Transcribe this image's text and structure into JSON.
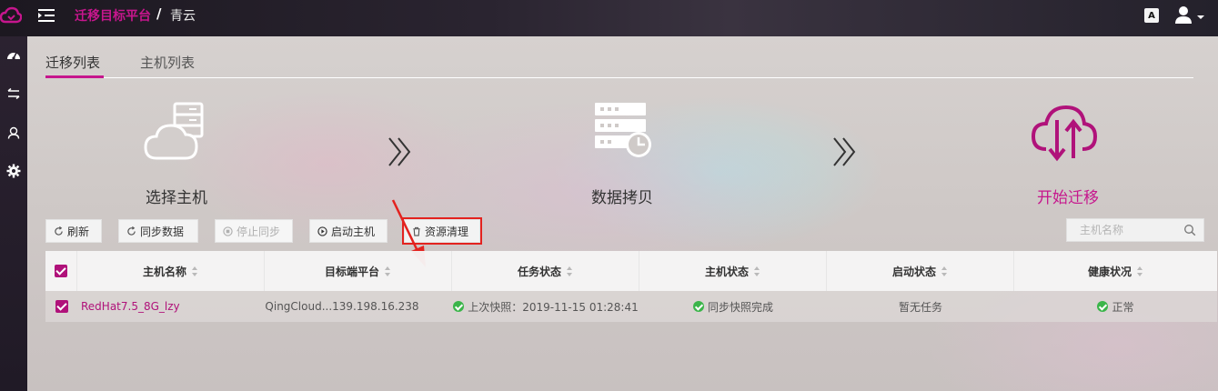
{
  "header": {
    "platform_title": "迁移目标平台",
    "separator": "/",
    "current": "青云",
    "lang_label": "A"
  },
  "sidebar": {
    "items": [
      {
        "icon": "dashboard-icon"
      },
      {
        "icon": "swap-icon"
      },
      {
        "icon": "user-icon"
      },
      {
        "icon": "gear-icon"
      }
    ]
  },
  "tabs": [
    {
      "label": "迁移列表",
      "active": true
    },
    {
      "label": "主机列表",
      "active": false
    }
  ],
  "steps": [
    {
      "label": "选择主机",
      "icon": "cloud-server-icon",
      "active": false
    },
    {
      "label": "数据拷贝",
      "icon": "server-clock-icon",
      "active": false
    },
    {
      "label": "开始迁移",
      "icon": "cloud-transfer-icon",
      "active": true
    }
  ],
  "toolbar": {
    "refresh": "刷新",
    "sync": "同步数据",
    "stop_sync": "停止同步",
    "start_host": "启动主机",
    "cleanup": "资源清理"
  },
  "search": {
    "placeholder": "主机名称"
  },
  "table": {
    "columns": [
      "主机名称",
      "目标端平台",
      "任务状态",
      "主机状态",
      "启动状态",
      "健康状况"
    ],
    "rows": [
      {
        "checked": true,
        "host": "RedHat7.5_8G_lzy",
        "platform": "QingCloud...139.198.16.238",
        "task_status": "上次快照：2019-11-15 01:28:41",
        "host_status": "同步快照完成",
        "boot_status": "暂无任务",
        "health": "正常"
      }
    ]
  },
  "colors": {
    "accent": "#c6168d",
    "ok": "#3bb54a",
    "highlight": "#e3221f"
  }
}
